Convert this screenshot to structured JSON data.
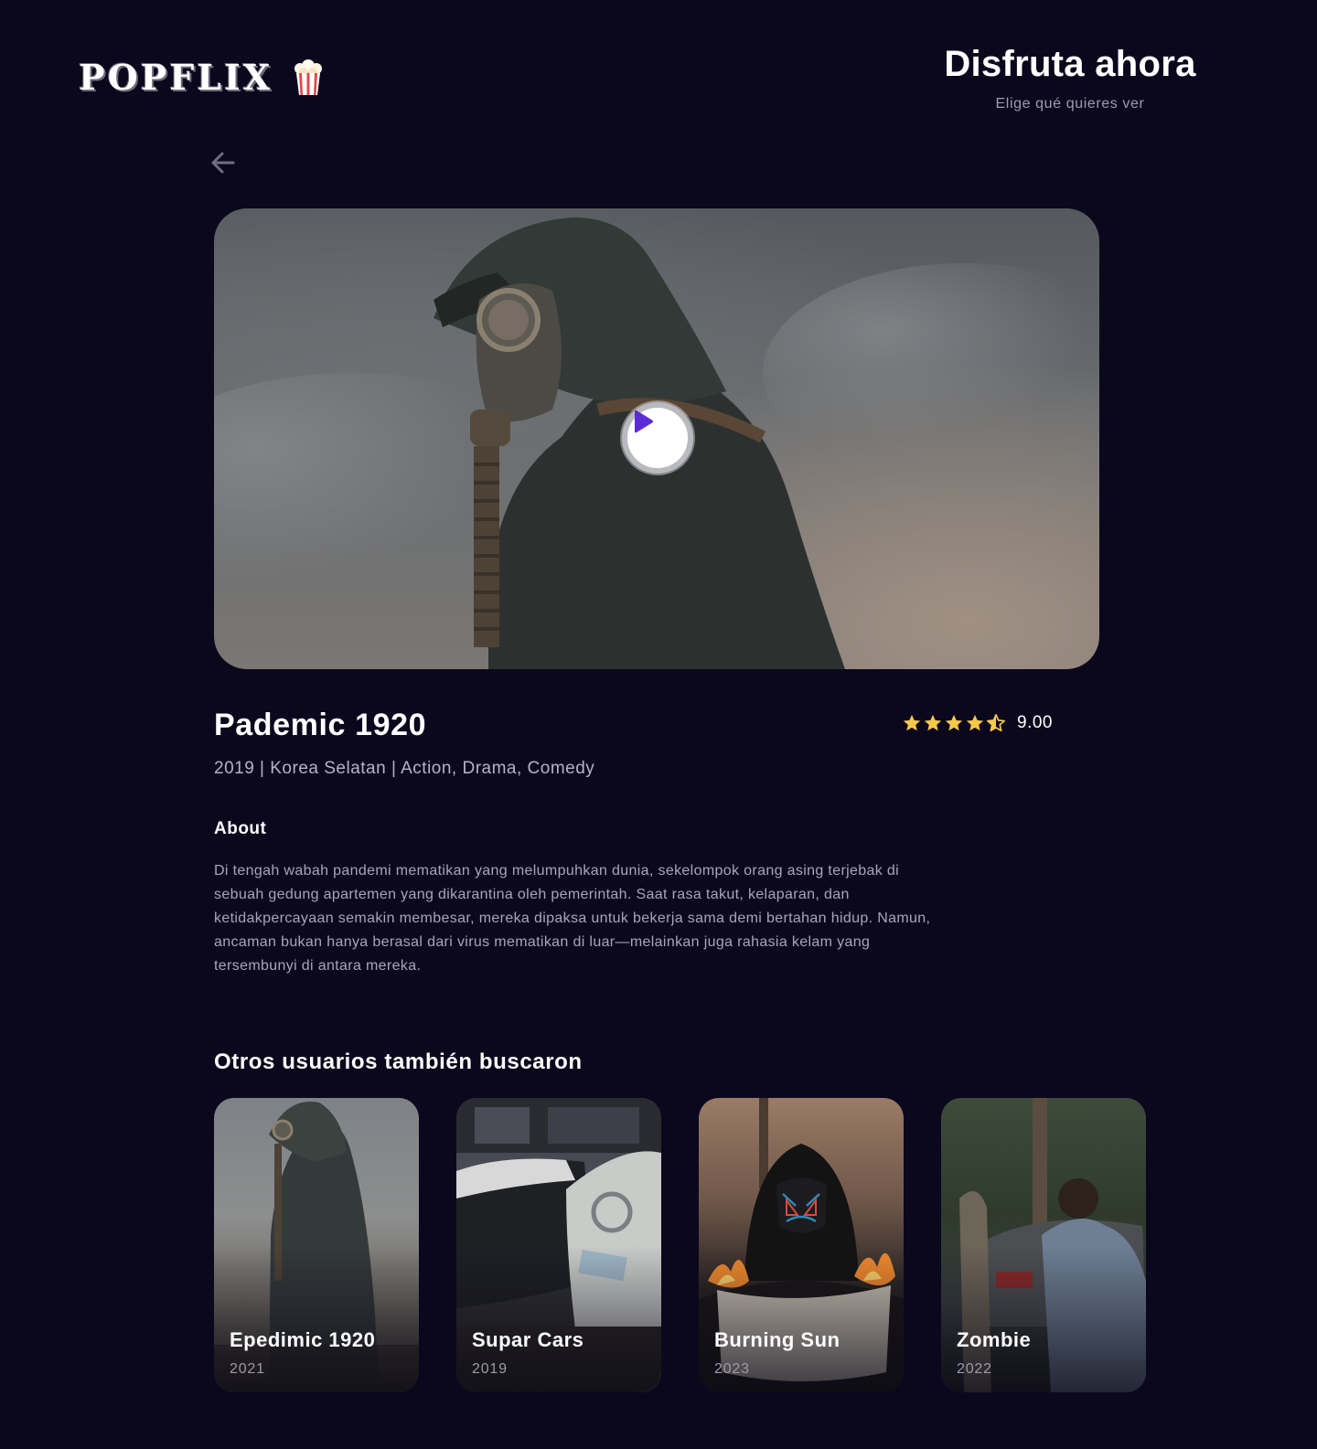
{
  "header": {
    "logo_text": "POPFLIX",
    "logo_icon": "popcorn-icon",
    "title": "Disfruta ahora",
    "subtitle": "Elige qué quieres ver"
  },
  "nav": {
    "back_icon": "arrow-left-icon"
  },
  "hero": {
    "play_icon": "play-icon",
    "accent": "#5b2bd8"
  },
  "movie": {
    "title": "Pademic 1920",
    "meta": "2019 | Korea Selatan | Action, Drama, Comedy",
    "rating": {
      "stars": 4.5,
      "max_stars": 5,
      "value": "9.00",
      "star_color": "#f7c94a"
    },
    "about_heading": "About",
    "about_text": "Di tengah wabah pandemi mematikan yang melumpuhkan dunia, sekelompok orang asing terjebak di sebuah gedung apartemen yang dikarantina oleh pemerintah. Saat rasa takut, kelaparan, dan ketidakpercayaan semakin membesar, mereka dipaksa untuk bekerja sama demi bertahan hidup. Namun, ancaman bukan hanya berasal dari virus mematikan di luar—melainkan juga rahasia kelam yang tersembunyi di antara mereka."
  },
  "related": {
    "title": "Otros usuarios también buscaron",
    "items": [
      {
        "title": "Epedimic 1920",
        "year": "2021"
      },
      {
        "title": "Supar Cars",
        "year": "2019"
      },
      {
        "title": "Burning Sun",
        "year": "2023"
      },
      {
        "title": "Zombie",
        "year": "2022"
      }
    ]
  },
  "colors": {
    "background": "#0b081d",
    "text_primary": "#ffffff",
    "text_secondary": "#a7a6b7"
  }
}
